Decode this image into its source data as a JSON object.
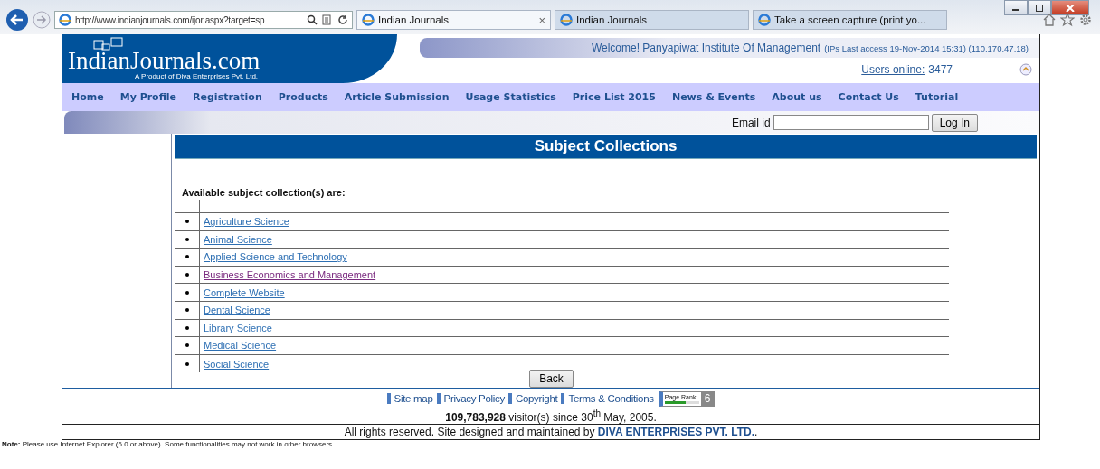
{
  "browser": {
    "address": "http://www.indianjournals.com/ijor.aspx?target=sp",
    "tabs": [
      {
        "label": "Indian Journals",
        "selected": true,
        "close": "×"
      },
      {
        "label": "Indian Journals",
        "selected": false
      },
      {
        "label": "Take a screen capture (print yo...",
        "selected": false
      }
    ]
  },
  "header": {
    "logo": "IndianJournals.com",
    "tagline": "A Product of Diva Enterprises Pvt. Ltd.",
    "welcome": "Welcome! Panyapiwat Institute Of Management",
    "last_access": "(IPs Last access 19-Nov-2014 15:31) (110.170.47.18)",
    "users_online_label": "Users online:",
    "users_online": "3477"
  },
  "nav": [
    "Home",
    "My Profile",
    "Registration",
    "Products",
    "Article Submission",
    "Usage Statistics",
    "Price List 2015",
    "News & Events",
    "About us",
    "Contact Us",
    "Tutorial"
  ],
  "login": {
    "label": "Email id",
    "button": "Log In"
  },
  "content": {
    "title": "Subject Collections",
    "intro": "Available subject collection(s) are:",
    "items": [
      {
        "label": "Agriculture Science",
        "visited": false
      },
      {
        "label": "Animal Science",
        "visited": false
      },
      {
        "label": "Applied Science and Technology",
        "visited": false
      },
      {
        "label": "Business Economics and Management",
        "visited": true
      },
      {
        "label": "Complete Website",
        "visited": false
      },
      {
        "label": "Dental Science",
        "visited": false
      },
      {
        "label": "Library Science",
        "visited": false
      },
      {
        "label": "Medical Science",
        "visited": false
      },
      {
        "label": "Social Science",
        "visited": false
      }
    ],
    "back": "Back"
  },
  "footer": {
    "links": [
      "Site map",
      "Privacy Policy",
      "Copyright",
      "Terms & Conditions"
    ],
    "pagerank": {
      "label": "Page Rank",
      "value": "6",
      "level": 0.6
    },
    "visitors": "**109,783,928** visitor(s) since 30$^{th}$ May, 2005.",
    "rights": "All rights reserved. Site designed and maintained by",
    "company": "DIVA ENTERPRISES PVT. LTD.",
    "rights_end": ".",
    "note": "**Note:** Please use Internet Explorer (6.0 or above). Some functionalities may not work in other browsers."
  }
}
